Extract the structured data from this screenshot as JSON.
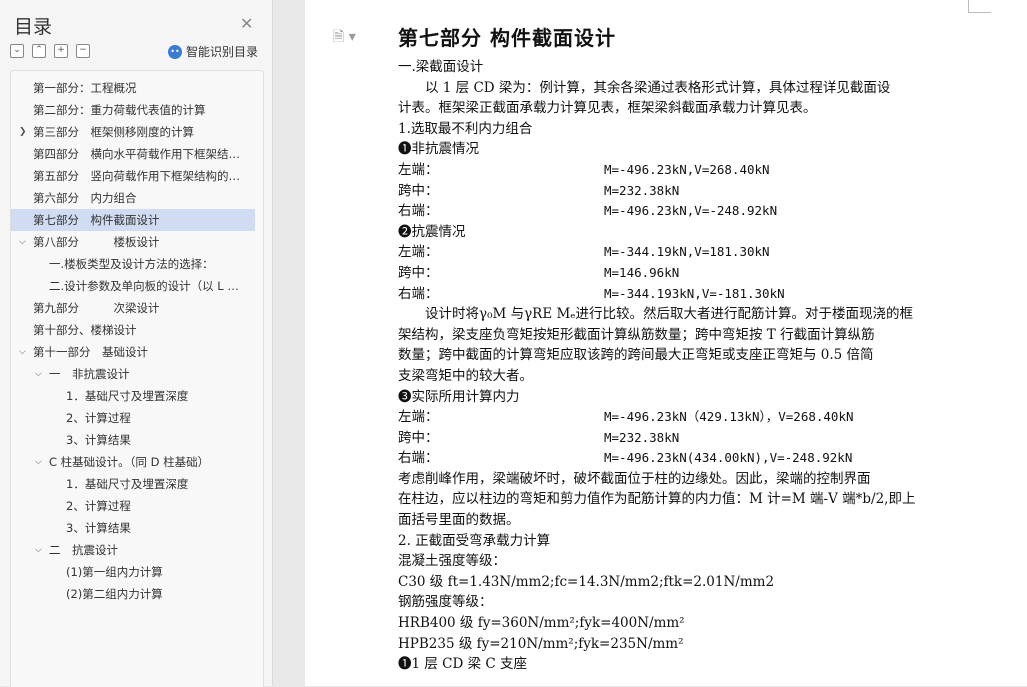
{
  "sidebar": {
    "title": "目录",
    "ai_label": "智能识别目录",
    "toc": [
      {
        "label": "第一部分：工程概况",
        "indent": 0,
        "chevron": "",
        "active": false
      },
      {
        "label": "第二部分：重力荷载代表值的计算",
        "indent": 0,
        "chevron": "",
        "active": false
      },
      {
        "label": "第三部分　框架侧移刚度的计算",
        "indent": 0,
        "chevron": ">",
        "active": false
      },
      {
        "label": "第四部分　横向水平荷载作用下框架结构的内力和侧移计算",
        "indent": 0,
        "chevron": "",
        "active": false
      },
      {
        "label": "第五部分　竖向荷载作用下框架结构的内力计算",
        "indent": 0,
        "chevron": "",
        "active": false
      },
      {
        "label": "第六部分　内力组合",
        "indent": 0,
        "chevron": "",
        "active": false
      },
      {
        "label": "第七部分　构件截面设计",
        "indent": 0,
        "chevron": "",
        "active": true
      },
      {
        "label": "第八部分　　　楼板设计",
        "indent": 0,
        "chevron": "v",
        "active": false
      },
      {
        "label": "一.楼板类型及设计方法的选择：",
        "indent": 1,
        "chevron": "",
        "active": false
      },
      {
        "label": "二.设计参数及单向板的设计（以 L 板为例）",
        "indent": 1,
        "chevron": "",
        "active": false
      },
      {
        "label": "第九部分　　　次梁设计",
        "indent": 0,
        "chevron": "",
        "active": false
      },
      {
        "label": "第十部分、楼梯设计",
        "indent": 0,
        "chevron": "",
        "active": false
      },
      {
        "label": "第十一部分　基础设计",
        "indent": 0,
        "chevron": "v",
        "active": false
      },
      {
        "label": "一　非抗震设计",
        "indent": 1,
        "chevron": "v",
        "active": false
      },
      {
        "label": "1．基础尺寸及埋置深度",
        "indent": 2,
        "chevron": "",
        "active": false
      },
      {
        "label": "2、计算过程",
        "indent": 2,
        "chevron": "",
        "active": false
      },
      {
        "label": "3、计算结果",
        "indent": 2,
        "chevron": "",
        "active": false
      },
      {
        "label": "C 柱基础设计。（同 D 柱基础）",
        "indent": 1,
        "chevron": "v",
        "active": false
      },
      {
        "label": "1．基础尺寸及埋置深度",
        "indent": 2,
        "chevron": "",
        "active": false
      },
      {
        "label": "2、计算过程",
        "indent": 2,
        "chevron": "",
        "active": false
      },
      {
        "label": "3、计算结果",
        "indent": 2,
        "chevron": "",
        "active": false
      },
      {
        "label": "二　抗震设计",
        "indent": 1,
        "chevron": "v",
        "active": false
      },
      {
        "label": "(1)第一组内力计算",
        "indent": 2,
        "chevron": "",
        "active": false
      },
      {
        "label": "(2)第二组内力计算",
        "indent": 2,
        "chevron": "",
        "active": false
      }
    ]
  },
  "doc": {
    "heading": "第七部分  构件截面设计",
    "lines": [
      {
        "t": "一.梁截面设计"
      },
      {
        "t": "　　以 1 层 CD 梁为：例计算，其余各梁通过表格形式计算，具体过程详见截面设"
      },
      {
        "t": "计表。框架梁正截面承载力计算见表，框架梁斜截面承载力计算见表。"
      },
      {
        "t": "1.选取最不利内力组合"
      },
      {
        "t": "❶非抗震情况"
      },
      {
        "k": "左端：",
        "v": "M=-496.23kN,V=268.40kN"
      },
      {
        "k": "跨中：",
        "v": "  M=232.38kN"
      },
      {
        "k": "右端：",
        "v": "M=-496.23kN,V=-248.92kN"
      },
      {
        "t": "❷抗震情况"
      },
      {
        "k": "左端：",
        "v": "M=-344.19kN,V=181.30kN"
      },
      {
        "k": "跨中：",
        "v": "  M=146.96kN"
      },
      {
        "k": "右端：",
        "v": "M=-344.193kN,V=-181.30kN"
      },
      {
        "t": "　　设计时将γ₀M 与γRE Mₑ进行比较。然后取大者进行配筋计算。对于楼面现浇的框"
      },
      {
        "t": "架结构，梁支座负弯矩按矩形截面计算纵筋数量；跨中弯矩按 T 行截面计算纵筋"
      },
      {
        "t": "数量；跨中截面的计算弯矩应取该跨的跨间最大正弯矩或支座正弯矩与 0.5 倍简"
      },
      {
        "t": "支梁弯矩中的较大者。"
      },
      {
        "t": "❸实际所用计算内力"
      },
      {
        "k": "左端：",
        "v": "M=-496.23kN（429.13kN），V=268.40kN"
      },
      {
        "k": "跨中：",
        "v": "  M=232.38kN"
      },
      {
        "k": "右端：",
        "v": "M=-496.23kN(434.00kN),V=-248.92kN"
      },
      {
        "t": "考虑削峰作用，梁端破坏时，破坏截面位于柱的边缘处。因此，梁端的控制界面"
      },
      {
        "t": "在柱边，应以柱边的弯矩和剪力值作为配筋计算的内力值：M 计=M 端-V 端*b/2,即上"
      },
      {
        "t": "面括号里面的数据。"
      },
      {
        "t": "2. 正截面受弯承载力计算"
      },
      {
        "t": "混凝土强度等级："
      },
      {
        "t": "C30 级 ft=1.43N/mm2;fc=14.3N/mm2;ftk=2.01N/mm2"
      },
      {
        "t": "钢筋强度等级："
      },
      {
        "t": "HRB400 级 fy=360N/mm²;fyk=400N/mm²"
      },
      {
        "t": "HPB235 级 fy=210N/mm²;fyk=235N/mm²"
      },
      {
        "t": "❶1 层 CD 梁 C 支座"
      }
    ]
  }
}
